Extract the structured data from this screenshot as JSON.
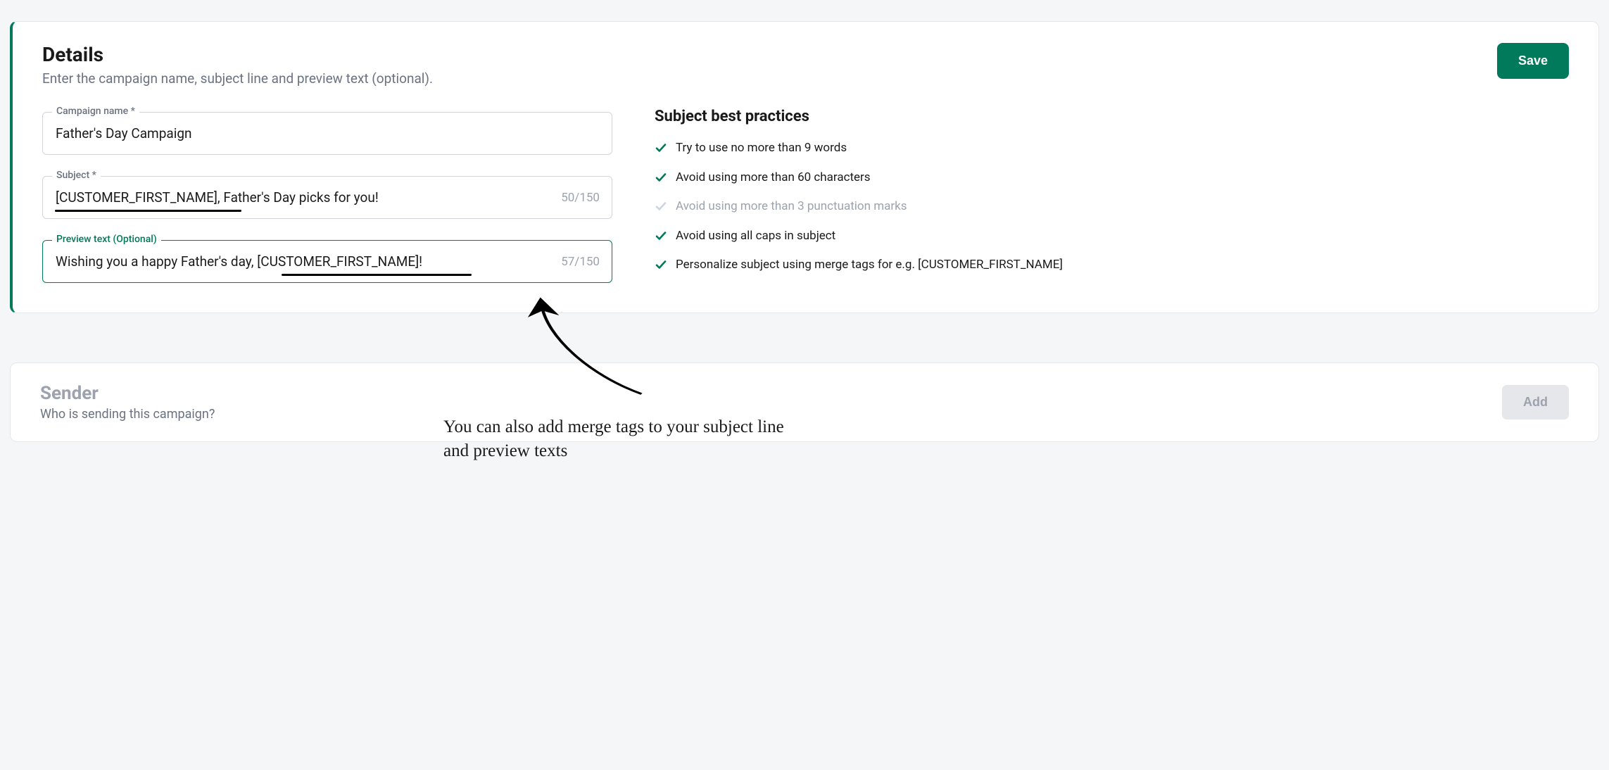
{
  "details": {
    "title": "Details",
    "subtitle": "Enter the campaign name, subject line and preview text (optional).",
    "save_label": "Save",
    "campaign_name": {
      "label": "Campaign name *",
      "value": "Father's Day Campaign"
    },
    "subject": {
      "label": "Subject *",
      "value": "[CUSTOMER_FIRST_NAME], Father's Day picks for you!",
      "counter": "50/150"
    },
    "preview_text": {
      "label": "Preview text (Optional)",
      "value": "Wishing you a happy Father's day, [CUSTOMER_FIRST_NAME]!",
      "counter": "57/150"
    }
  },
  "best_practices": {
    "title": "Subject best practices",
    "items": [
      {
        "text": "Try to use no more than 9 words",
        "ok": true
      },
      {
        "text": "Avoid using more than 60 characters",
        "ok": true
      },
      {
        "text": "Avoid using more than 3 punctuation marks",
        "ok": false
      },
      {
        "text": "Avoid using all caps in subject",
        "ok": true
      },
      {
        "text": "Personalize subject using merge tags for e.g. [CUSTOMER_FIRST_NAME]",
        "ok": true
      }
    ]
  },
  "sender": {
    "title": "Sender",
    "subtitle": "Who is sending this campaign?",
    "add_label": "Add"
  },
  "annotation": {
    "text": "You can also add merge tags to your subject line\nand preview texts"
  }
}
